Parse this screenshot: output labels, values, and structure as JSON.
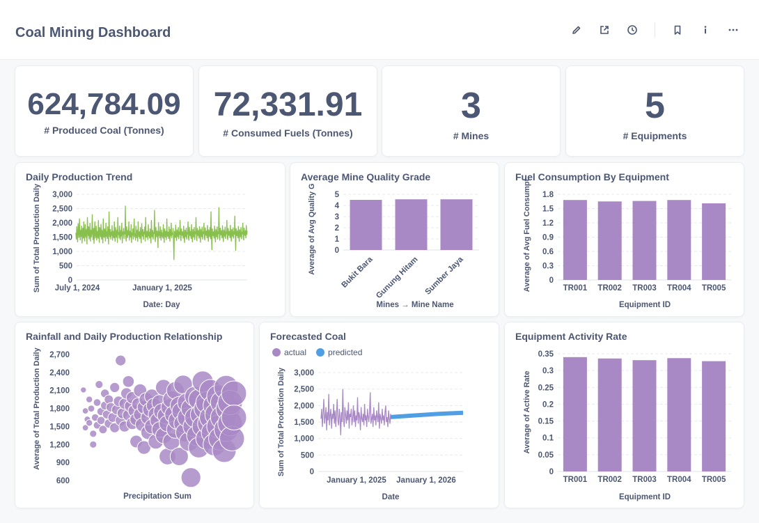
{
  "header": {
    "title": "Coal Mining Dashboard",
    "icons": [
      "pencil-icon",
      "share-icon",
      "clock-icon",
      "bookmark-icon",
      "info-icon",
      "more-icon"
    ]
  },
  "colors": {
    "purple": "#a989c5",
    "blue": "#509ee3",
    "green": "#88bf4d",
    "text": "#4c5773",
    "grid": "#e7eaee"
  },
  "scalars": [
    {
      "value": "624,784.09",
      "label": "# Produced Coal (Tonnes)"
    },
    {
      "value": "72,331.91",
      "label": "# Consumed Fuels (Tonnes)"
    },
    {
      "value": "3",
      "label": "# Mines"
    },
    {
      "value": "5",
      "label": "# Equipments"
    }
  ],
  "chart_data": [
    {
      "id": "daily",
      "type": "line",
      "title": "Daily Production Trend",
      "xlabel": "Date: Day",
      "ylabel": "Sum of Total Production Daily",
      "x_range": [
        "2024-07-01",
        "2025-06-30"
      ],
      "x_ticks": [
        "July 1, 2024",
        "January 1, 2025"
      ],
      "ylim": [
        0,
        3000
      ],
      "y_ticks": [
        "0",
        "500",
        "1,000",
        "1,500",
        "2,000",
        "2,500",
        "3,000"
      ],
      "series": [
        {
          "color": "#88bf4d",
          "values": [
            1650,
            1420,
            1880,
            1550,
            1320,
            1980,
            1720,
            1480,
            2150,
            1600,
            1390,
            1760,
            1510,
            1900,
            1280,
            1700,
            1830,
            1450,
            2050,
            1560,
            1350,
            1950,
            1620,
            1480,
            1790,
            1250,
            2200,
            1680,
            1540,
            1880,
            1420,
            1600,
            2000,
            1350,
            1750,
            1500,
            1640,
            2300,
            1580,
            1400,
            1820,
            1270,
            1690,
            2050,
            1460,
            1560,
            1900,
            1380,
            1720,
            1600,
            1450,
            2100,
            1550,
            1300,
            1850,
            1680,
            1500,
            1960,
            1420,
            1750,
            1620,
            1280,
            2150,
            1570,
            1480,
            1800,
            1650,
            1350,
            2000,
            1520,
            1700,
            1440,
            1880,
            1600,
            1250,
            2400,
            1650,
            1500,
            1780,
            1420,
            1690,
            1550,
            1920,
            1380,
            1720,
            1600,
            1460,
            2050,
            1500,
            1340,
            1850,
            1620,
            1480,
            1760,
            1300,
            2200,
            1570,
            1680,
            1450,
            1900,
            1620,
            1400,
            1750,
            1530,
            2000,
            1280,
            1690,
            1580,
            1820,
            1440,
            1700,
            1600,
            2600,
            1500,
            1350,
            1880,
            1640,
            1470,
            1750,
            1560,
            2050,
            1380,
            1720,
            1600,
            1480,
            1950,
            1300,
            1660,
            1550,
            1800,
            1420,
            1700,
            2150,
            1500,
            1630,
            1380,
            1900,
            1580,
            1460,
            1760,
            1340,
            2050,
            1620,
            1500,
            1700,
            1440,
            1850,
            1560,
            1290,
            1980,
            1650,
            1520,
            1780,
            1410,
            1690,
            1600,
            1870,
            1350,
            2200,
            1550,
            1480,
            1720,
            1620,
            1400,
            1950,
            1530,
            1680,
            1450,
            1800,
            1600,
            1280,
            2100,
            1570,
            1500,
            1750,
            1420,
            1680,
            1610,
            2450,
            1490,
            1330,
            1860,
            1640,
            1500,
            1730,
            1560,
            1120,
            2020,
            1550,
            1700,
            1460,
            1880,
            1600,
            1380,
            1760,
            1520,
            1650,
            1450,
            1950,
            1570,
            1300,
            1800,
            1630,
            1490,
            1720,
            1400,
            2150,
            1580,
            1520,
            1690,
            1440,
            1870,
            1600,
            1350,
            1780,
            1540,
            2000,
            1470,
            1660,
            1580,
            1820,
            1410,
            700,
            1720,
            1600,
            1480,
            1940,
            1530,
            1370,
            1770,
            1640,
            1500,
            1850,
            1430,
            1690,
            1580,
            2100,
            1490,
            1360,
            1800,
            1620,
            1550,
            1700,
            1450,
            1900,
            1570,
            1300,
            1760,
            1650,
            1500,
            1830,
            1420,
            1680,
            1590,
            2050,
            1470,
            1380,
            1860,
            1610,
            1530,
            1720,
            1440,
            1950,
            1560,
            1320,
            1780,
            1640,
            1490,
            1850,
            1400,
            1700,
            1600,
            2200,
            1500,
            1360,
            1820,
            1630,
            1540,
            1750,
            1450,
            1880,
            1580,
            1310,
            1790,
            1650,
            1500,
            1860,
            1420,
            1690,
            1610,
            2000,
            1480,
            1390,
            1840,
            1620,
            1550,
            1730,
            1460,
            1920,
            1570,
            1340,
            1770,
            1640,
            1510,
            1850,
            1430,
            2400,
            1600,
            1050,
            1800,
            1620,
            1540,
            1700,
            1450,
            1900,
            1580,
            1320,
            1780,
            1650,
            1500,
            1870,
            1420,
            1700,
            1610,
            2550,
            1490,
            1380,
            1830,
            1630,
            1560,
            1740,
            1460,
            1910,
            1570,
            1330,
            1760,
            1650,
            1520,
            1860,
            1440,
            1690,
            1600,
            2100,
            1480,
            1400,
            1820,
            1610,
            1550,
            1720,
            1470,
            1930,
            1560,
            1350,
            1780,
            1640,
            1510,
            1840,
            1450,
            1700,
            1590,
            2250,
            1500,
            1020,
            1810,
            1620,
            1540,
            1730,
            1460,
            1890,
            1570,
            1340,
            1770,
            1650,
            1500,
            1850,
            1430,
            1680,
            1600,
            2000,
            1490,
            1390,
            1830,
            1630,
            1550,
            1740,
            1460,
            1920,
            1580,
            1720
          ]
        }
      ]
    },
    {
      "id": "quality",
      "type": "bar",
      "title": "Average Mine Quality Grade",
      "xlabel": "Mines → Mine Name",
      "ylabel": "Average of Avg Quality G",
      "categories": [
        "Bukit Bara",
        "Gunung Hitam",
        "Sumber Jaya"
      ],
      "values": [
        4.5,
        4.55,
        4.55
      ],
      "ylim": [
        0,
        5
      ],
      "y_ticks": [
        "0",
        "1",
        "2",
        "3",
        "4",
        "5"
      ]
    },
    {
      "id": "fuel",
      "type": "bar",
      "title": "Fuel Consumption By Equipment",
      "xlabel": "Equipment ID",
      "ylabel": "Average of Avg Fuel Consumpt",
      "categories": [
        "TR001",
        "TR002",
        "TR003",
        "TR004",
        "TR005"
      ],
      "values": [
        1.68,
        1.65,
        1.66,
        1.68,
        1.61
      ],
      "ylim": [
        0,
        1.8
      ],
      "y_ticks": [
        "0",
        "0.3",
        "0.6",
        "0.9",
        "1.2",
        "1.5",
        "1.8"
      ]
    },
    {
      "id": "rainfall",
      "type": "scatter",
      "title": "Rainfall and Daily Production Relationship",
      "xlabel": "Precipitation Sum",
      "ylabel": "Average of Total Production Daily",
      "ylim": [
        600,
        2700
      ],
      "y_ticks": [
        "600",
        "900",
        "1,200",
        "1,500",
        "1,800",
        "2,100",
        "2,400",
        "2,700"
      ],
      "points": [
        [
          0.5,
          2110
        ],
        [
          1,
          1760
        ],
        [
          1,
          1480
        ],
        [
          1.5,
          1620
        ],
        [
          2,
          1950
        ],
        [
          2,
          1560
        ],
        [
          2.5,
          1800
        ],
        [
          3,
          1380
        ],
        [
          3,
          1200
        ],
        [
          3.5,
          1650
        ],
        [
          4,
          1900
        ],
        [
          4,
          1520
        ],
        [
          4.5,
          2200
        ],
        [
          5,
          1750
        ],
        [
          5,
          1600
        ],
        [
          5.5,
          1450
        ],
        [
          6,
          1850
        ],
        [
          6,
          2050
        ],
        [
          6.5,
          1700
        ],
        [
          7,
          1550
        ],
        [
          7,
          1950
        ],
        [
          7.5,
          1820
        ],
        [
          8,
          1650
        ],
        [
          8.5,
          2150
        ],
        [
          8.5,
          1480
        ],
        [
          9,
          1780
        ],
        [
          9.5,
          1920
        ],
        [
          10,
          1600
        ],
        [
          10,
          2600
        ],
        [
          10.5,
          1720
        ],
        [
          11,
          1880
        ],
        [
          11,
          1500
        ],
        [
          11.5,
          2050
        ],
        [
          12,
          1690
        ],
        [
          12,
          2250
        ],
        [
          12.5,
          1840
        ],
        [
          13,
          1550
        ],
        [
          13,
          1980
        ],
        [
          13.5,
          1760
        ],
        [
          14,
          1620
        ],
        [
          14,
          1250
        ],
        [
          14.5,
          1870
        ],
        [
          15,
          1700
        ],
        [
          15,
          2100
        ],
        [
          15.5,
          1530
        ],
        [
          16,
          1820
        ],
        [
          16,
          1150
        ],
        [
          16.5,
          1950
        ],
        [
          17,
          1650
        ],
        [
          17,
          1400
        ],
        [
          17.5,
          1780
        ],
        [
          18,
          2000
        ],
        [
          18,
          1500
        ],
        [
          18.5,
          1850
        ],
        [
          19,
          1700
        ],
        [
          19,
          1250
        ],
        [
          19.5,
          1600
        ],
        [
          20,
          1900
        ],
        [
          20,
          1450
        ],
        [
          20.5,
          1750
        ],
        [
          21,
          2150
        ],
        [
          21,
          1350
        ],
        [
          21.5,
          1680
        ],
        [
          22,
          1550
        ],
        [
          22,
          1000
        ],
        [
          22.5,
          1820
        ],
        [
          23,
          1950
        ],
        [
          23,
          1250
        ],
        [
          23.5,
          1700
        ],
        [
          24,
          2100
        ],
        [
          24,
          1450
        ],
        [
          24.5,
          1600
        ],
        [
          25,
          1850
        ],
        [
          25,
          1000
        ],
        [
          25.5,
          1750
        ],
        [
          26,
          1550
        ],
        [
          26,
          2200
        ],
        [
          26.5,
          1400
        ],
        [
          27,
          1900
        ],
        [
          27,
          1650
        ],
        [
          27.5,
          1250
        ],
        [
          28,
          1800
        ],
        [
          28,
          650
        ],
        [
          28.5,
          1500
        ],
        [
          29,
          2000
        ],
        [
          29,
          1650
        ],
        [
          29.5,
          1350
        ],
        [
          30,
          1950
        ],
        [
          30,
          1150
        ],
        [
          30.5,
          1700
        ],
        [
          31,
          2250
        ],
        [
          31,
          1500
        ],
        [
          31.5,
          1800
        ],
        [
          32,
          1300
        ],
        [
          32,
          1900
        ],
        [
          32.5,
          1550
        ],
        [
          33,
          2100
        ],
        [
          33,
          1650
        ],
        [
          33.5,
          1400
        ],
        [
          34,
          1850
        ],
        [
          34,
          1200
        ],
        [
          34.5,
          1700
        ],
        [
          35,
          2000
        ],
        [
          35,
          1500
        ],
        [
          35.5,
          1300
        ],
        [
          36,
          1900
        ],
        [
          36,
          1650
        ],
        [
          36.5,
          1100
        ],
        [
          37,
          2150
        ],
        [
          37,
          1450
        ],
        [
          37.5,
          1800
        ],
        [
          38,
          1550
        ],
        [
          38,
          1900
        ],
        [
          38.5,
          1300
        ],
        [
          39,
          2050
        ],
        [
          39,
          1650
        ]
      ]
    },
    {
      "id": "forecast",
      "type": "line",
      "title": "Forecasted Coal",
      "xlabel": "Date",
      "ylabel": "Sum of Total Production Daily",
      "x_ticks": [
        "January 1, 2025",
        "January 1, 2026"
      ],
      "ylim": [
        0,
        3000
      ],
      "y_ticks": [
        "0",
        "500",
        "1,000",
        "1,500",
        "2,000",
        "2,500",
        "3,000"
      ],
      "series": [
        {
          "name": "actual",
          "color": "#a989c5",
          "values": [
            1600,
            1900,
            1350,
            1750,
            2200,
            1450,
            1650,
            1950,
            1250,
            1800,
            1550,
            2350,
            1400,
            1700,
            1900,
            1300,
            1750,
            1600,
            2050,
            1450,
            1850,
            1350,
            1700,
            2200,
            1550,
            1400,
            1900,
            1650,
            1100,
            1800,
            1500,
            2500,
            1600,
            1350,
            1950,
            1700,
            1450,
            1850,
            1550,
            2100,
            1300,
            1750,
            1650,
            1900,
            1400,
            1600,
            2000,
            1500,
            1850,
            1350,
            1700,
            1550,
            2250,
            1450,
            1800,
            1650,
            1250,
            1950,
            1600,
            1500,
            1750,
            1400,
            2050,
            1550,
            1700,
            1350,
            1900,
            1650,
            1500,
            1800,
            2400,
            1450,
            1600,
            1750,
            1350,
            1950,
            1550,
            1700,
            1400,
            1850,
            1650,
            1500,
            2100,
            1300,
            1750,
            1600,
            1450,
            1900,
            1550,
            1700,
            1400,
            1800,
            2000,
            1500,
            1650,
            1350,
            1850,
            1600,
            1450,
            1750
          ]
        },
        {
          "name": "predicted",
          "color": "#509ee3",
          "values": [
            1650,
            1700,
            1750,
            1780
          ]
        }
      ]
    },
    {
      "id": "activity",
      "type": "bar",
      "title": "Equipment Activity Rate",
      "xlabel": "Equipment ID",
      "ylabel": "Average of Active Rate",
      "categories": [
        "TR001",
        "TR002",
        "TR003",
        "TR004",
        "TR005"
      ],
      "values": [
        0.34,
        0.336,
        0.331,
        0.337,
        0.328
      ],
      "ylim": [
        0,
        0.35
      ],
      "y_ticks": [
        "0",
        "0.05",
        "0.1",
        "0.15",
        "0.2",
        "0.25",
        "0.3",
        "0.35"
      ]
    }
  ]
}
